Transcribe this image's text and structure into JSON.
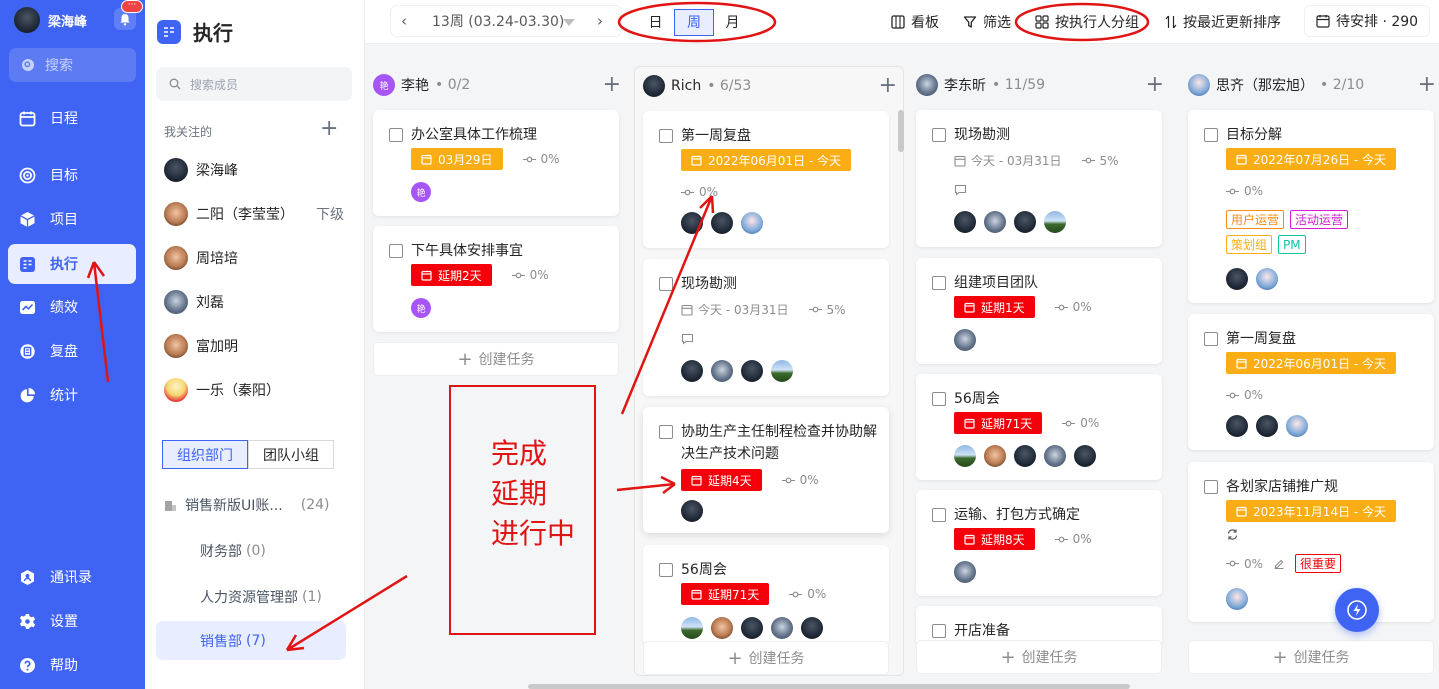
{
  "app": {
    "user_name": "梁海峰",
    "notification_more": "···",
    "search_label": "搜索"
  },
  "nav": {
    "items": [
      {
        "label": "日程",
        "icon": "calendar-icon"
      },
      {
        "label": "目标",
        "icon": "target-icon"
      },
      {
        "label": "项目",
        "icon": "cube-icon"
      },
      {
        "label": "执行",
        "icon": "board-icon"
      },
      {
        "label": "绩效",
        "icon": "chart-icon"
      },
      {
        "label": "复盘",
        "icon": "review-icon"
      },
      {
        "label": "统计",
        "icon": "pie-icon"
      }
    ],
    "bottom_items": [
      {
        "label": "通讯录",
        "icon": "contacts-icon"
      },
      {
        "label": "设置",
        "icon": "gear-icon"
      },
      {
        "label": "帮助",
        "icon": "help-icon"
      }
    ],
    "active_item": "执行"
  },
  "panel": {
    "title": "执行",
    "search_placeholder": "搜索成员",
    "following_title": "我关注的",
    "members": [
      {
        "name": "梁海峰",
        "sub": ""
      },
      {
        "name": "二阳（李莹莹）",
        "sub": "下级"
      },
      {
        "name": "周培培",
        "sub": ""
      },
      {
        "name": "刘磊",
        "sub": ""
      },
      {
        "name": "富加明",
        "sub": ""
      },
      {
        "name": "一乐（秦阳）",
        "sub": ""
      }
    ],
    "tabs": [
      "组织部门",
      "团队小组"
    ],
    "active_tab": "组织部门",
    "departments": [
      {
        "name": "销售新版UI账...",
        "count": "(24)"
      },
      {
        "name": "财务部",
        "count": "(0)"
      },
      {
        "name": "人力资源管理部",
        "count": "(1)"
      },
      {
        "name": "销售部",
        "count": "(7)"
      }
    ]
  },
  "topbar": {
    "week_label": "13周 (03.24-03.30)",
    "views": [
      "日",
      "周",
      "月"
    ],
    "active_view": "周",
    "board_label": "看板",
    "filter_label": "筛选",
    "group_label": "按执行人分组",
    "sort_label": "按最近更新排序",
    "pending_label": "待安排 · 290"
  },
  "columns": [
    {
      "name": "李艳",
      "count": "• 0/2",
      "avatar_text": "艳",
      "cards": [
        {
          "title": "办公室具体工作梳理",
          "badge": "03月29日",
          "badge_type": "orange",
          "progress": "0%"
        },
        {
          "title": "下午具体安排事宜",
          "badge": "延期2天",
          "badge_type": "red",
          "progress": "0%"
        }
      ],
      "create_label": "创建任务"
    },
    {
      "name": "Rich",
      "count": "• 6/53",
      "cards": [
        {
          "title": "第一周复盘",
          "badge": "2022年06月01日 - 今天",
          "badge_type": "orange",
          "progress": "0%"
        },
        {
          "title": "现场勘测",
          "date": "今天 - 03月31日",
          "progress": "5%"
        },
        {
          "title": "协助生产主任制程检查并协助解决生产技术问题",
          "badge": "延期4天",
          "badge_type": "red",
          "progress": "0%"
        },
        {
          "title": "56周会",
          "badge": "延期71天",
          "badge_type": "red",
          "progress": "0%"
        }
      ],
      "create_label": "创建任务"
    },
    {
      "name": "李东昕",
      "count": "• 11/59",
      "cards": [
        {
          "title": "现场勘测",
          "date": "今天 - 03月31日",
          "progress": "5%"
        },
        {
          "title": "组建项目团队",
          "badge": "延期1天",
          "badge_type": "red",
          "progress": "0%"
        },
        {
          "title": "56周会",
          "badge": "延期71天",
          "badge_type": "red",
          "progress": "0%"
        },
        {
          "title": "运输、打包方式确定",
          "badge": "延期8天",
          "badge_type": "red",
          "progress": "0%"
        },
        {
          "title": "开店准备"
        }
      ],
      "create_label": "创建任务"
    },
    {
      "name": "思齐（那宏旭）",
      "count": "• 2/10",
      "cards": [
        {
          "title": "目标分解",
          "badge": "2022年07月26日 - 今天",
          "badge_type": "orange",
          "progress": "0%",
          "tags": [
            {
              "label": "用户运营",
              "color": "#fa8c16"
            },
            {
              "label": "活动运营",
              "color": "#d51ad5"
            },
            {
              "label": "策划组",
              "color": "#faad14"
            },
            {
              "label": "PM",
              "color": "#13c2a3"
            }
          ]
        },
        {
          "title": "第一周复盘",
          "badge": "2022年06月01日 - 今天",
          "badge_type": "orange",
          "progress": "0%"
        },
        {
          "title": "各划家店铺推广规",
          "badge": "2023年11月14日 - 今天",
          "badge_type": "orange",
          "progress": "0%",
          "priority": "很重要"
        }
      ],
      "create_label": "创建任务"
    }
  ],
  "annotation": {
    "lines": [
      "完成",
      "延期",
      "进行中"
    ]
  },
  "colors": {
    "brand": "#3f63f2",
    "overdue": "#f5000a",
    "due": "#faad14",
    "annotation": "#e11414"
  }
}
